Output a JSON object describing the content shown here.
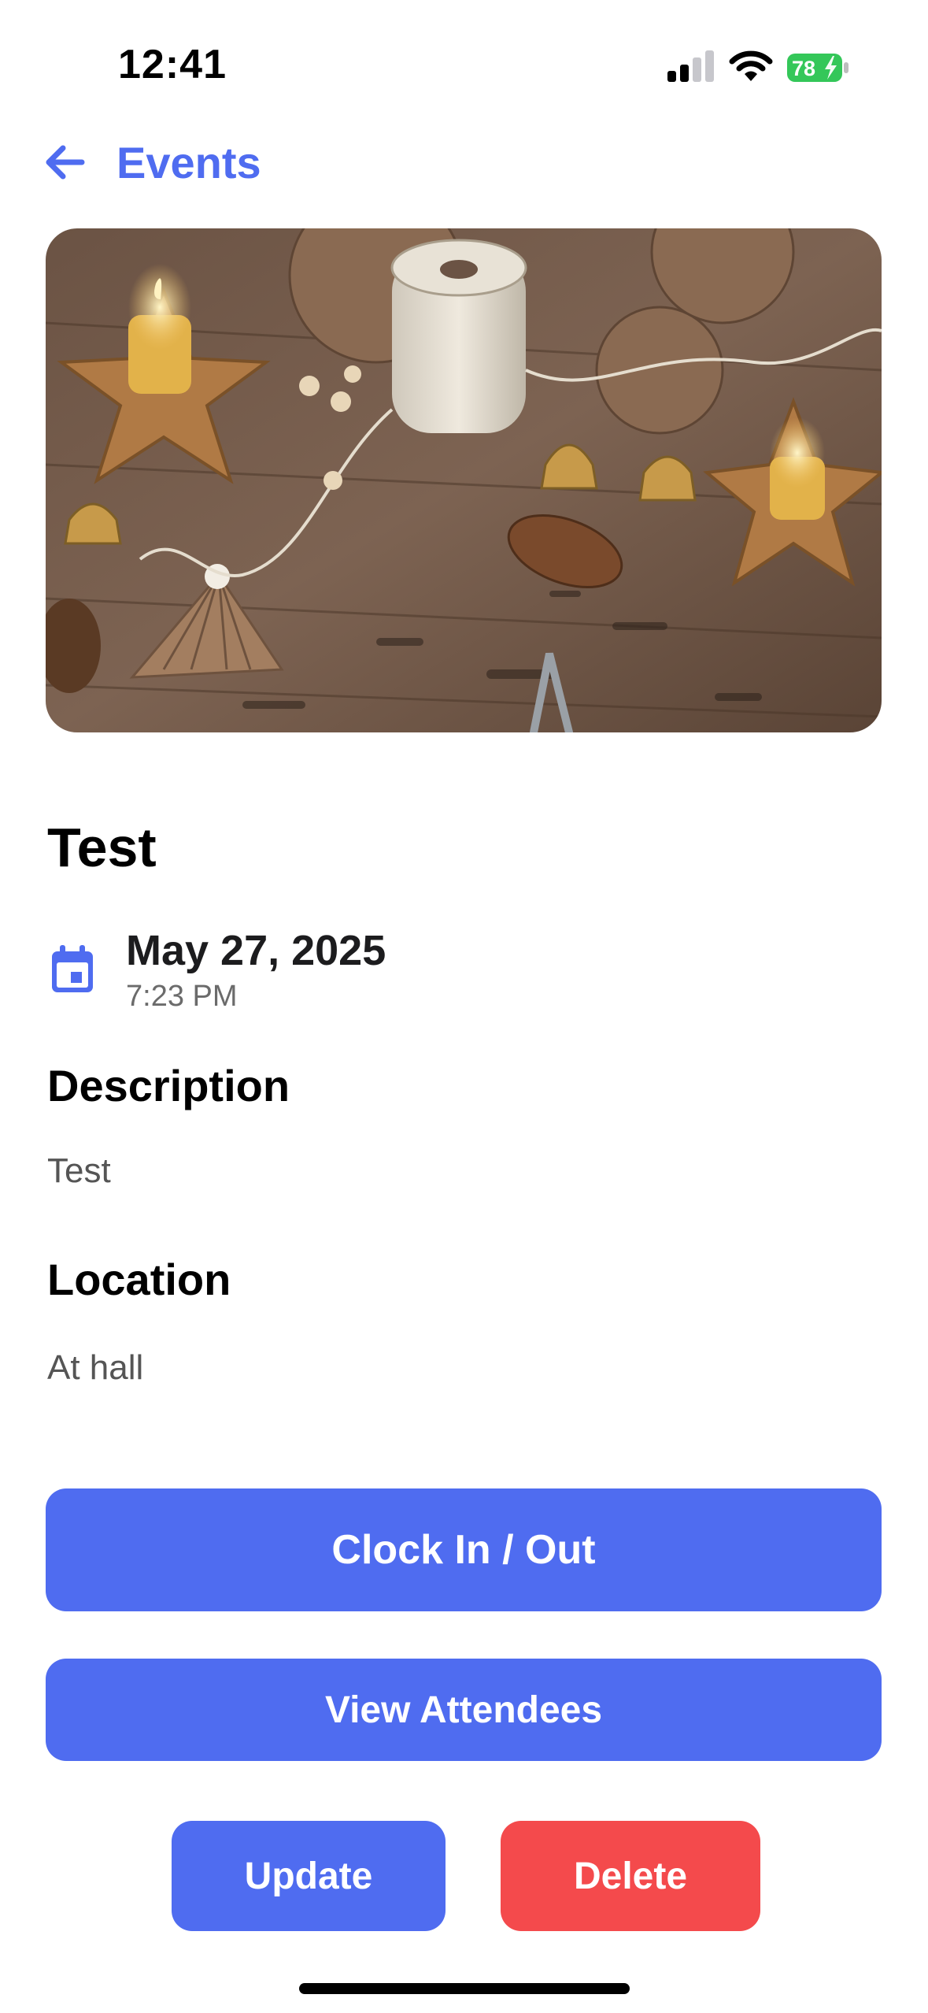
{
  "status_bar": {
    "time": "12:41",
    "battery_percent": "78",
    "battery_charging": true,
    "signal_bars_active": 2,
    "signal_bars_total": 4
  },
  "nav": {
    "back_label": "Events",
    "back_icon": "arrow-left-icon"
  },
  "event": {
    "image_subject": "rustic christmas craft decorations",
    "title": "Test",
    "date": "May 27, 2025",
    "time": "7:23 PM",
    "date_icon": "calendar-icon"
  },
  "sections": {
    "description_heading": "Description",
    "description_text": "Test",
    "location_heading": "Location",
    "location_text": "At hall"
  },
  "actions": {
    "clock_label": "Clock In / Out",
    "attendees_label": "View Attendees",
    "update_label": "Update",
    "delete_label": "Delete"
  },
  "colors": {
    "accent": "#4f6cf0",
    "danger": "#f44a4c",
    "battery": "#34c759"
  }
}
